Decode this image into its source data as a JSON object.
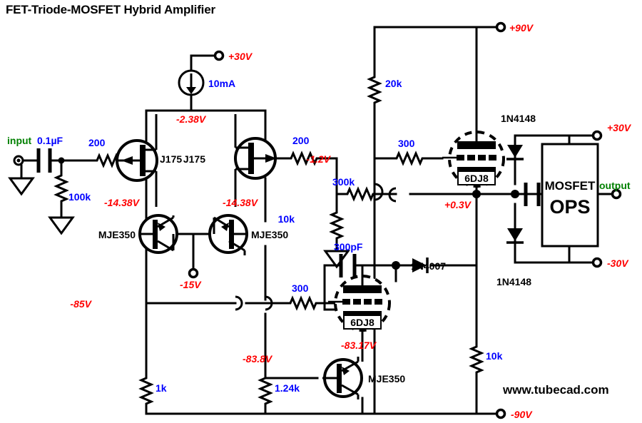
{
  "title": "FET-Triode-MOSFET Hybrid Amplifier",
  "watermark": "www.tubecad.com",
  "colors": {
    "wire": "#000000",
    "component_value": "#0000ff",
    "node_voltage": "#ff0000",
    "port_label": "#008000",
    "part_name": "#000000",
    "background": "#ffffff"
  },
  "ports": {
    "input": "input",
    "output": "output",
    "v_plus_30_top": "+30V",
    "v_plus_90": "+90V",
    "v_plus_30_ops": "+30V",
    "v_minus_30_ops": "-30V",
    "v_minus_15": "-15V",
    "v_minus_90": "-90V"
  },
  "components": {
    "c_in": "0.1µF",
    "r_grid_leak": "100k",
    "r_gate_left": "200",
    "r_gate_right": "200",
    "i_source": "10mA",
    "r_10k_mid": "10k",
    "r_300k": "300k",
    "c_300pF": "300pF",
    "r_20k": "20k",
    "r_300_top": "300",
    "r_300_bot": "300",
    "r_1k": "1k",
    "r_1k24": "1.24k",
    "r_10k_right": "10k",
    "d_1n4007": "1N4007",
    "d_1n4148_top": "1N4148",
    "d_1n4148_bot": "1N4148"
  },
  "devices": {
    "jfet_left": "J175",
    "jfet_right": "J175",
    "bjt_left": "MJE350",
    "bjt_right": "MJE350",
    "bjt_bottom": "MJE350",
    "tube_top": "6DJ8",
    "tube_bottom": "6DJ8",
    "ops_line1": "MOSFET",
    "ops_line2": "OPS"
  },
  "node_voltages": {
    "jfet_sources": "-2.38V",
    "jfet_left_drain": "-14.38V",
    "jfet_right_drain": "-14.38V",
    "tube_top_grid": "-1.2V",
    "tube_top_cathode": "+0.3V",
    "neg_85": "-85V",
    "neg_83_8": "-83.8V",
    "tube_bottom_cathode": "-83.17V"
  }
}
